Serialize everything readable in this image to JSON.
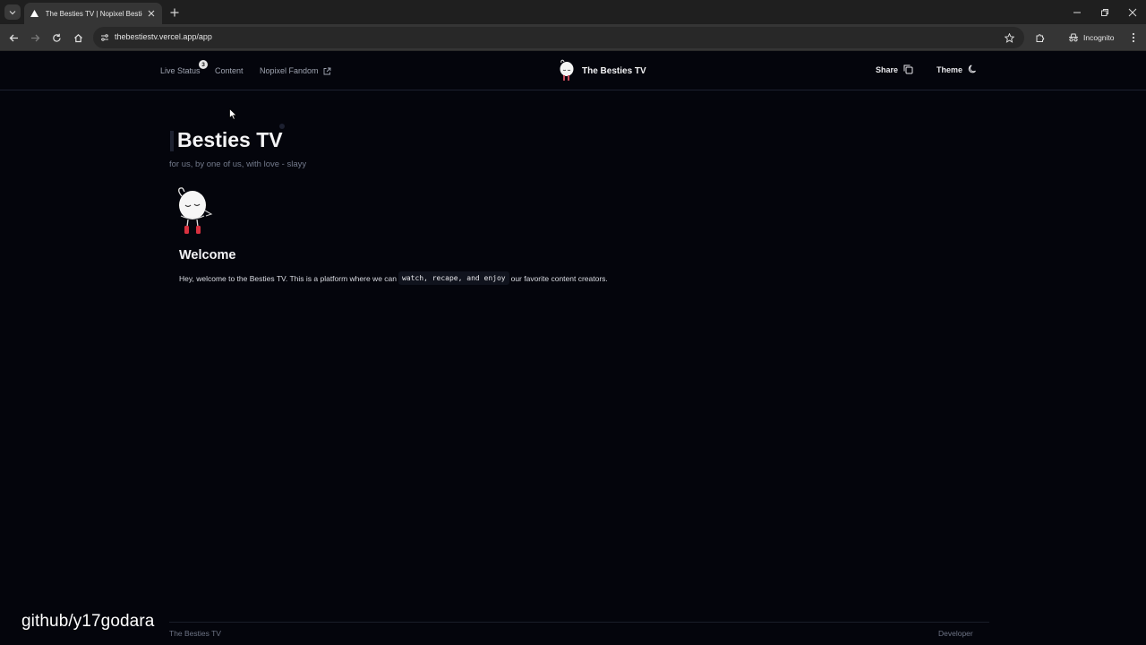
{
  "browser": {
    "tab_title": "The Besties TV | Nopixel Besties",
    "url": "thebestiestv.vercel.app/app",
    "profile_label": "Incognito"
  },
  "header": {
    "nav": {
      "live_status": "Live Status",
      "live_count": "3",
      "content": "Content",
      "fandom": "Nopixel Fandom"
    },
    "brand": "The Besties TV",
    "share": "Share",
    "theme": "Theme"
  },
  "main": {
    "title": "Besties TV",
    "subtitle": "for us, by one of us, with love - slayy",
    "welcome_heading": "Welcome",
    "welcome_pre": "Hey, welcome to the Besties TV. This is a platform where we can",
    "welcome_code": "watch, recape, and enjoy",
    "welcome_post": "our favorite content creators."
  },
  "footer": {
    "left": "The Besties TV",
    "right": "Developer"
  },
  "overlay": {
    "watermark": "github/y17godara"
  },
  "colors": {
    "page_bg": "#04050c",
    "chrome_bg": "#353535",
    "tabstrip_bg": "#1f1f1f",
    "muted_text": "#737a8c"
  }
}
